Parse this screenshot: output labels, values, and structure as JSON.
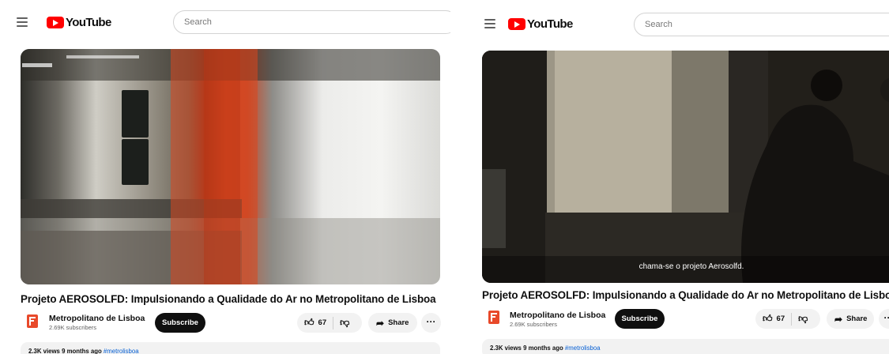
{
  "panels": [
    {
      "brand": "YouTube",
      "search_placeholder": "Search",
      "video_caption": "",
      "title": "Projeto AEROSOLFD: Impulsionando a Qualidade do Ar no Metropolitano de Lisboa",
      "channel": {
        "name": "Metropolitano de Lisboa",
        "subscribers": "2.69K subscribers"
      },
      "subscribe_label": "Subscribe",
      "likes": "67",
      "share_label": "Share",
      "more_label": "···",
      "description": {
        "views": "2.3K views",
        "age": "9 months ago",
        "hashtag": "#metrolisboa"
      }
    },
    {
      "brand": "YouTube",
      "search_placeholder": "Search",
      "video_caption": "chama-se o projeto Aerosolfd.",
      "title": "Projeto AEROSOLFD: Impulsionando a Qualidade do Ar no Metropolitano de Lisboa",
      "channel": {
        "name": "Metropolitano de Lisboa",
        "subscribers": "2.69K subscribers"
      },
      "subscribe_label": "Subscribe",
      "likes": "67",
      "share_label": "Share",
      "more_label": "···",
      "description": {
        "views": "2.3K views",
        "age": "9 months ago",
        "hashtag": "#metrolisboa"
      }
    }
  ],
  "colors": {
    "brand_red": "#ff0000",
    "text": "#0f0f0f",
    "muted": "#606060",
    "pill_bg": "#f2f2f2",
    "link": "#065fd4",
    "channel_logo": "#e8492a"
  }
}
